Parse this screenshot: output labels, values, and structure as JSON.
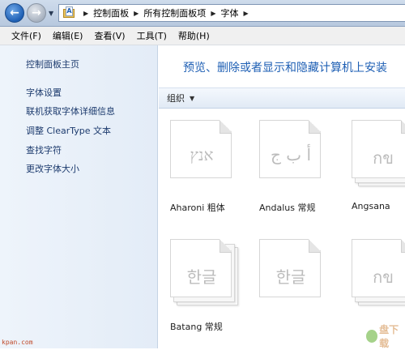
{
  "address_bar": {
    "crumbs": [
      "控制面板",
      "所有控制面板项",
      "字体"
    ]
  },
  "menu": {
    "items": [
      "文件(F)",
      "编辑(E)",
      "查看(V)",
      "工具(T)",
      "帮助(H)"
    ]
  },
  "sidebar": {
    "home": "控制面板主页",
    "items": [
      "字体设置",
      "联机获取字体详细信息",
      "调整 ClearType 文本",
      "查找字符",
      "更改字体大小"
    ]
  },
  "main": {
    "title": "预览、删除或者显示和隐藏计算机上安装",
    "organize_label": "组织",
    "fonts": [
      {
        "name": "Aharoni 粗体",
        "sample": "אנץ"
      },
      {
        "name": "Andalus 常规",
        "sample": "أ ب ج"
      },
      {
        "name": "Angsana",
        "sample": "กข"
      },
      {
        "name": "Batang 常规",
        "sample": "한글"
      },
      {
        "name": "",
        "sample": "한글"
      },
      {
        "name": "",
        "sample": "กข"
      }
    ]
  },
  "watermark": {
    "left": "kpan.com",
    "right": "盘下载"
  }
}
